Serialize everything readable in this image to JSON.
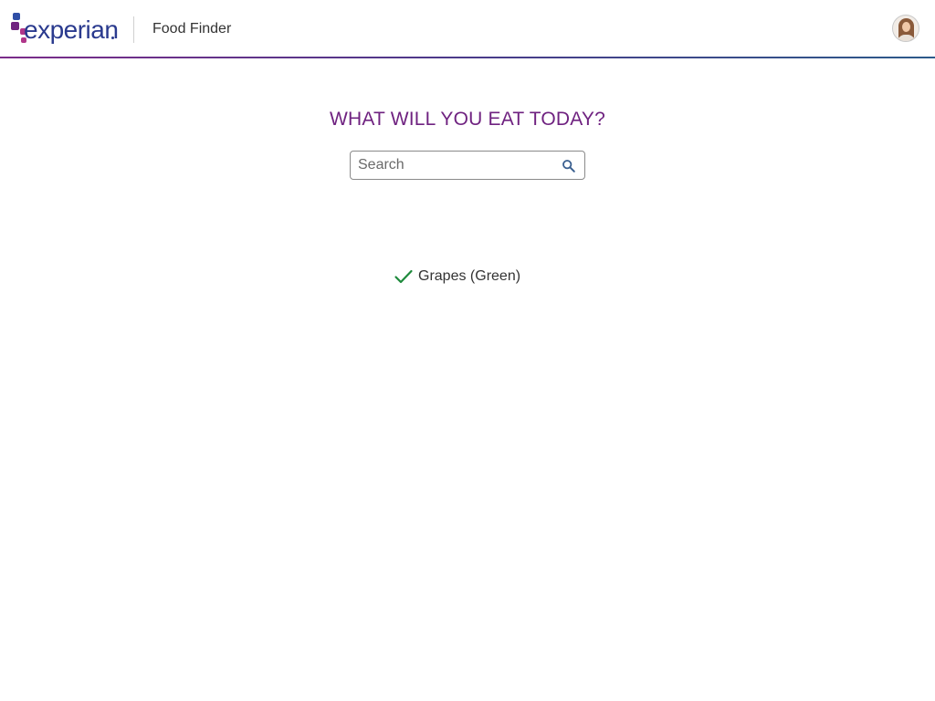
{
  "header": {
    "logo_text": "experian",
    "app_title": "Food Finder",
    "avatar_icon": "user-avatar",
    "brand_colors": {
      "purple": "#6f2280",
      "navy": "#2a3a8e",
      "magenta": "#b0368a",
      "blue": "#2f6db5"
    }
  },
  "main": {
    "heading": "WHAT WILL YOU EAT TODAY?",
    "search": {
      "placeholder": "Search",
      "value": "",
      "icon": "search-icon"
    },
    "results": [
      {
        "label": "Grapes (Green)",
        "icon": "check-icon",
        "icon_color": "#1e8a3c",
        "selected": true
      }
    ]
  }
}
